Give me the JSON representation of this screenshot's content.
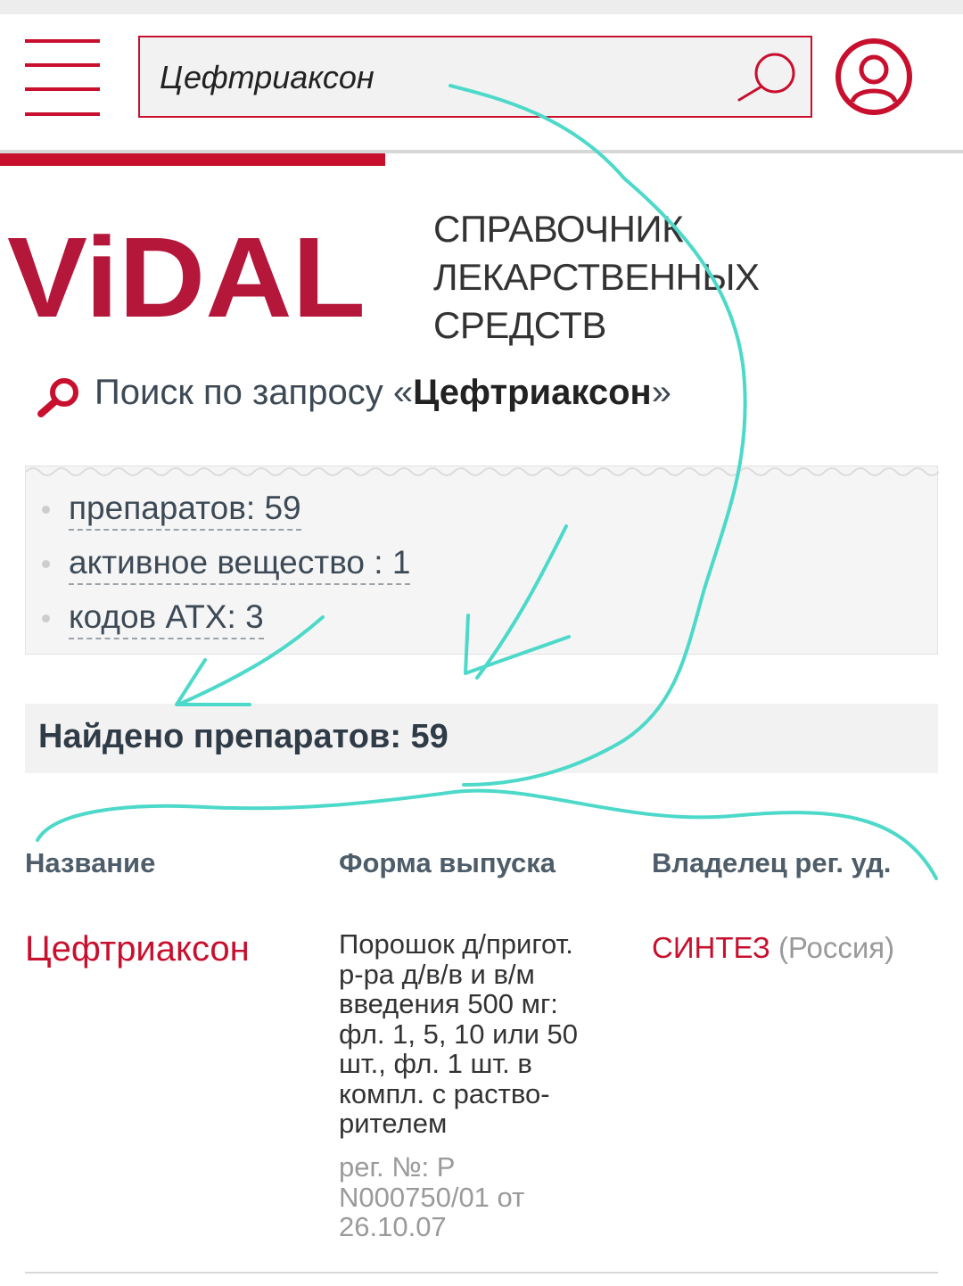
{
  "header": {
    "search_value": "Цефтриаксон",
    "accent_color": "#c8102e"
  },
  "brand": {
    "logo_text": "ViDAL",
    "tagline": [
      "СПРАВОЧНИК",
      "ЛЕКАРСТВЕННЫХ",
      "СРЕДСТВ"
    ]
  },
  "query": {
    "prefix": "Поиск по запросу «",
    "term": "Цефтриаксон",
    "suffix": "»"
  },
  "summary": {
    "items": [
      "препаратов: 59",
      "активное вещество : 1",
      "кодов АТХ: 3"
    ]
  },
  "found": {
    "text": "Найдено препаратов: 59"
  },
  "table": {
    "headers": [
      "Название",
      "Форма выпуска",
      "Владелец рег. уд."
    ],
    "rows": [
      {
        "name": "Цефтриаксон",
        "form": [
          "Порошок д/пригот.",
          "р-ра д/в/в и в/м",
          "введения 500 мг:",
          "фл. 1, 5, 10 или 50",
          "шт., фл. 1 шт. в",
          "компл. с раство-",
          "рителем"
        ],
        "reg": [
          "рег. №: Р",
          "N000750/01 от",
          "26.10.07"
        ],
        "owner": "СИНТЕЗ",
        "owner_country": "(Россия)"
      }
    ]
  },
  "annotation_color": "#4dd9c9"
}
